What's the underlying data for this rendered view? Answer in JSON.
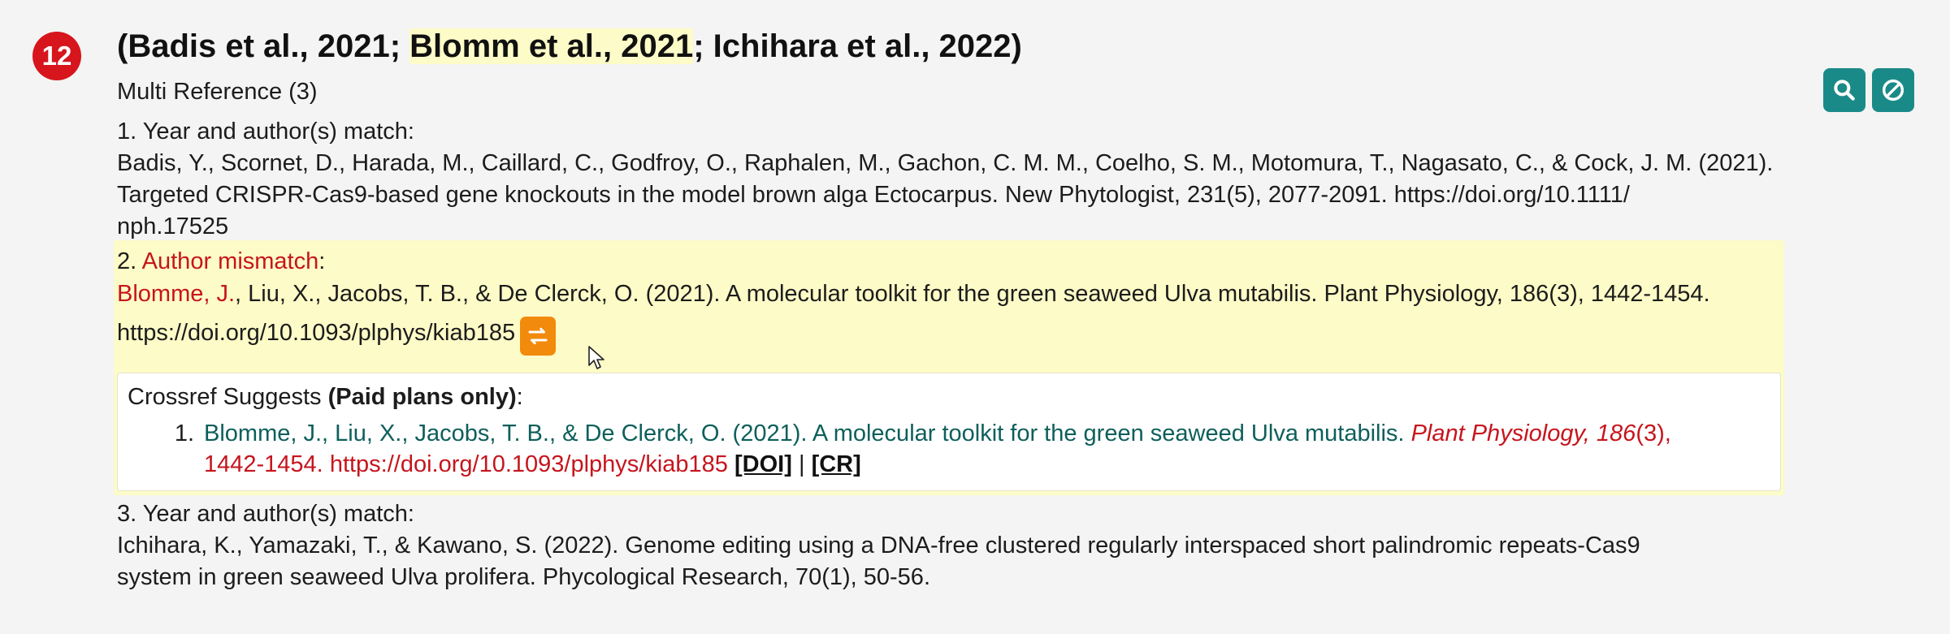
{
  "badge_number": "12",
  "title": {
    "open": "(",
    "cite1": "Badis et al., 2021",
    "sep1": "; ",
    "cite2": "Blomm et al., 2021",
    "sep2": "; ",
    "cite3": "Ichihara et al., 2022",
    "close": ")"
  },
  "subtitle": "Multi Reference (3)",
  "references": [
    {
      "status": "1. Year and author(s) match:",
      "text_line1": "Badis, Y., Scornet, D., Harada, M., Caillard, C., Godfroy, O., Raphalen, M., Gachon, C. M. M., Coelho, S. M., Motomura, T., Nagasato, C., & Cock, J. M. (2021).",
      "text_line2": "Targeted CRISPR-Cas9-based gene knockouts in the model brown alga Ectocarpus. New Phytologist, 231(5), 2077-2091. https://doi.org/10.1111/",
      "text_line3": "nph.17525"
    },
    {
      "status_prefix": "2. ",
      "status_label": "Author mismatch",
      "status_suffix": ":",
      "author_highlight": "Blomme, J.",
      "text_line1": ", Liu, X., Jacobs, T. B., & De Clerck, O. (2021). A molecular toolkit for the green seaweed Ulva mutabilis. Plant Physiology, 186(3), 1442-1454.",
      "text_line2": "https://doi.org/10.1093/plphys/kiab185",
      "swap_icon": "swap-arrows-icon"
    },
    {
      "status": "3. Year and author(s) match:",
      "text_line1": "Ichihara, K., Yamazaki, T., & Kawano, S. (2022). Genome editing using a DNA-free clustered regularly interspaced short palindromic repeats-Cas9",
      "text_line2": "system in green seaweed Ulva prolifera. Phycological Research, 70(1), 50-56."
    }
  ],
  "crossref": {
    "heading": "Crossref Suggests ",
    "heading_bold": "(Paid plans only)",
    "heading_colon": ":",
    "item_number": "1.",
    "teal_text": "Blomme, J., Liu, X., Jacobs, T. B., & De Clerck, O. (2021). A molecular toolkit for the green seaweed Ulva mutabilis.",
    "journal": "Plant Physiology, 186",
    "issue": "(3),",
    "pages": "1442-1454.",
    "doi_url": "https://doi.org/10.1093/plphys/kiab185",
    "doi_link": "[DOI]",
    "divider": "|",
    "cr_link": "[CR]"
  },
  "toolbar": {
    "search_icon": "search-icon",
    "ignore_icon": "ban-icon"
  },
  "colors": {
    "badge": "#d6151d",
    "highlight": "#fdfbc7",
    "mismatch_red": "#c6151d",
    "teal_button": "#1a8a88",
    "swap_orange": "#f28a0c",
    "suggest_teal": "#0d5f5b"
  }
}
